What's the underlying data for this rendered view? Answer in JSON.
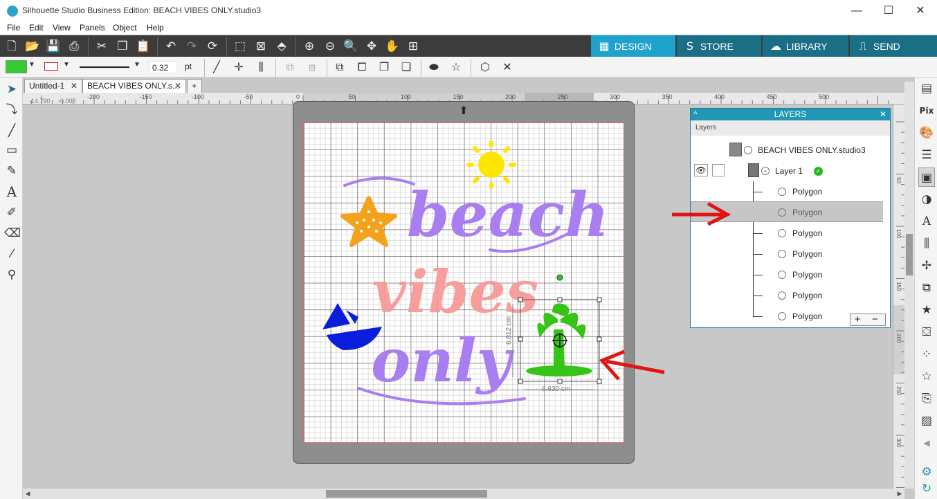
{
  "window": {
    "title": "Silhouette Studio Business Edition: BEACH VIBES ONLY.studio3",
    "controls": [
      "—",
      "☐",
      "✕"
    ]
  },
  "menu": [
    "File",
    "Edit",
    "View",
    "Panels",
    "Object",
    "Help"
  ],
  "nav_tabs": [
    {
      "label": "DESIGN",
      "icon": "grid-icon",
      "active": true
    },
    {
      "label": "STORE",
      "icon": "store-icon",
      "active": false
    },
    {
      "label": "LIBRARY",
      "icon": "cloud-icon",
      "active": false
    },
    {
      "label": "SEND",
      "icon": "cutter-icon",
      "active": false
    }
  ],
  "colors": {
    "accent": "#2297b5",
    "fill": "#33cc33",
    "line": "#cc2222",
    "toolbar_dark": "#3c3c3c",
    "design_tab": "#1fa3cc",
    "nav_tab": "#1a6e85"
  },
  "line_style": {
    "weight": "0.32",
    "unit": "pt"
  },
  "doc_tabs": [
    {
      "label": "Untitled-1",
      "close": "✕"
    },
    {
      "label": "BEACH VIBES ONLY.s...",
      "close": "✕"
    },
    {
      "label": "+"
    }
  ],
  "cursor_coords": {
    "x": "-14.790",
    "y": "-0.005"
  },
  "ruler_h": [
    "-200",
    "-150",
    "-100",
    "-50",
    "0",
    "50",
    "100",
    "150",
    "200",
    "250",
    "300",
    "350",
    "400",
    "450",
    "500"
  ],
  "ruler_v": [
    "50",
    "100",
    "150",
    "200",
    "250",
    "300"
  ],
  "design": {
    "words": [
      "beach",
      "vibes",
      "only"
    ],
    "width_label": "6.630 cm",
    "height_label": "6.812 cm"
  },
  "layers": {
    "title": "LAYERS",
    "subheader": "Layers",
    "collapse": "^",
    "close": "✕",
    "document": "BEACH VIBES ONLY.studio3",
    "layer": "Layer 1",
    "items": [
      "Polygon",
      "Polygon",
      "Polygon",
      "Polygon",
      "Polygon",
      "Polygon",
      "Polygon"
    ],
    "add": "+",
    "remove": "−"
  }
}
